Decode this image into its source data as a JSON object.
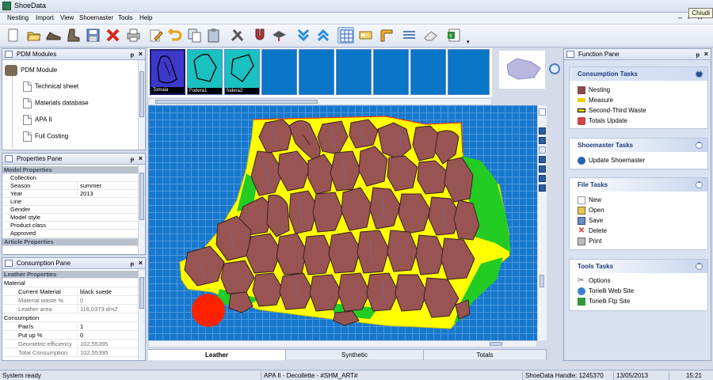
{
  "window": {
    "title": "ShoeData",
    "tooltip": "Chiudi"
  },
  "menu": {
    "items": [
      "Nesting",
      "Import",
      "View",
      "Shoemaster",
      "Tools",
      "Help"
    ]
  },
  "pdm_pane": {
    "title": "PDM Modules",
    "root": "PDM Module",
    "items": [
      "Technical sheet",
      "Materials database",
      "APA II",
      "Full Costing"
    ]
  },
  "properties_pane": {
    "title": "Properties Pane",
    "category1": "Model Properties",
    "rows": [
      [
        "Collection",
        ""
      ],
      [
        "Season",
        "summer"
      ],
      [
        "Year",
        "2013"
      ],
      [
        "Line",
        ""
      ],
      [
        "Gender",
        ""
      ],
      [
        "Model style",
        ""
      ],
      [
        "Product class",
        ""
      ],
      [
        "Approved",
        ""
      ]
    ],
    "category2": "Article Properties"
  },
  "consumption_pane": {
    "title": "Consumption Pane",
    "category": "Leather Properties",
    "section1": "Material",
    "rows1": [
      [
        "Current Material",
        "black suede"
      ],
      [
        "Material waste %",
        "0"
      ],
      [
        "Leather area",
        "116,0373 dm2"
      ]
    ],
    "section2": "Consumption",
    "rows2": [
      [
        "Pair/s",
        "1"
      ],
      [
        "Put up %",
        "0"
      ],
      [
        "Geometric efficiency",
        "102,55395"
      ],
      [
        "Total Consumption",
        "102,55395"
      ]
    ]
  },
  "thumbnails": [
    "Tomaia",
    "Fodera1",
    "fodera2",
    "",
    "",
    "",
    "",
    "",
    ""
  ],
  "tabs": {
    "leather": "Leather",
    "synthetic": "Synthetic",
    "totals": "Totals"
  },
  "function_pane": {
    "title": "Function Pane",
    "groups": [
      {
        "title": "Consumption Tasks",
        "items": [
          {
            "label": "Nesting",
            "icon": "nesting-icon"
          },
          {
            "label": "Measure",
            "icon": "measure-icon"
          },
          {
            "label": "Second-Third Waste",
            "icon": "waste-icon"
          },
          {
            "label": "Totals Update",
            "icon": "totals-update-icon"
          }
        ]
      },
      {
        "title": "Shoemaster Tasks",
        "items": [
          {
            "label": "Update Shoemaster",
            "icon": "update-icon"
          }
        ]
      },
      {
        "title": "File Tasks",
        "items": [
          {
            "label": "New",
            "icon": "new-icon"
          },
          {
            "label": "Open",
            "icon": "open-icon"
          },
          {
            "label": "Save",
            "icon": "save-icon"
          },
          {
            "label": "Delete",
            "icon": "delete-icon"
          },
          {
            "label": "Print",
            "icon": "print-icon"
          }
        ]
      },
      {
        "title": "Tools Tasks",
        "items": [
          {
            "label": "Options",
            "icon": "options-icon"
          },
          {
            "label": "Torielli Web Site",
            "icon": "web-icon"
          },
          {
            "label": "Torielli Ftp Site",
            "icon": "ftp-icon"
          }
        ]
      }
    ]
  },
  "status": {
    "left": "System ready",
    "doc": "APA II - Decollette - #SHM_ART#",
    "handle": "ShoeData Handle: 1245370",
    "date": "13/05/2013",
    "time": "15:21"
  },
  "colors": {
    "canvas": "#1778cd",
    "leather_yellow": "#ffff00",
    "leather_green": "#22cc22",
    "piece": "#985353",
    "defect": "#ff2200"
  }
}
